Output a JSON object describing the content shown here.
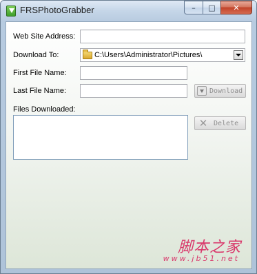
{
  "window": {
    "title": "FRSPhotoGrabber",
    "controls": {
      "minimize": "–",
      "maximize": "□",
      "close": "✕"
    }
  },
  "form": {
    "web_site_address": {
      "label": "Web Site Address:",
      "value": ""
    },
    "download_to": {
      "label": "Download To:",
      "value": "C:\\Users\\Administrator\\Pictures\\"
    },
    "first_file_name": {
      "label": "First File Name:",
      "value": ""
    },
    "last_file_name": {
      "label": "Last File Name:",
      "value": ""
    },
    "files_downloaded": {
      "label": "Files Downloaded:",
      "items": []
    }
  },
  "buttons": {
    "download": "Download",
    "delete": "Delete"
  },
  "watermark": {
    "text": "脚本之家",
    "url": "www.jb51.net"
  },
  "icons": [
    "app-download-icon",
    "folder-icon",
    "chevron-down-icon",
    "download-icon",
    "delete-x-icon"
  ],
  "colors": {
    "titlebar": "#c5d6e8",
    "close_button": "#c1432a",
    "disabled_text": "#8e8e8e",
    "watermark": "#d9386b"
  }
}
